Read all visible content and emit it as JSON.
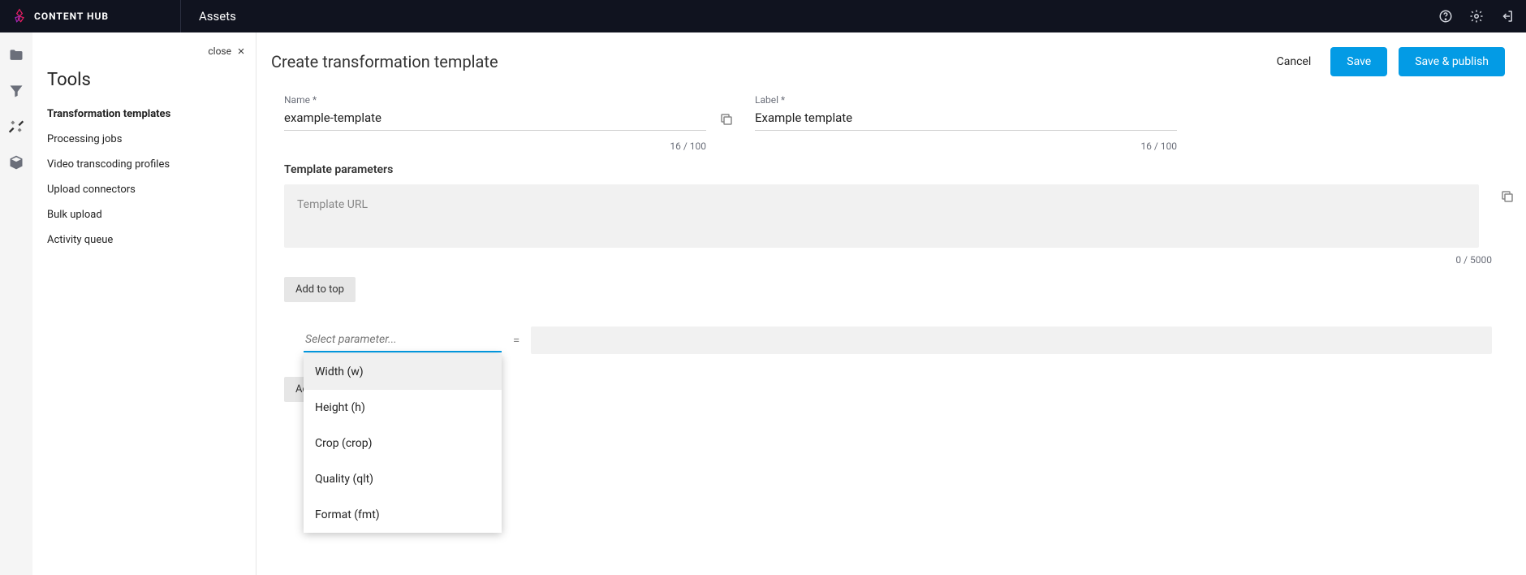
{
  "brand": {
    "name": "CONTENT HUB"
  },
  "topbar": {
    "section": "Assets"
  },
  "sidebar": {
    "close_label": "close",
    "title": "Tools",
    "items": [
      {
        "label": "Transformation templates",
        "active": true
      },
      {
        "label": "Processing jobs"
      },
      {
        "label": "Video transcoding profiles"
      },
      {
        "label": "Upload connectors"
      },
      {
        "label": "Bulk upload"
      },
      {
        "label": "Activity queue"
      }
    ]
  },
  "page": {
    "title": "Create transformation template",
    "cancel_label": "Cancel",
    "save_label": "Save",
    "save_publish_label": "Save & publish"
  },
  "form": {
    "name_label": "Name *",
    "name_value": "example-template",
    "name_count": "16 / 100",
    "label_label": "Label *",
    "label_value": "Example template",
    "label_count": "16 / 100",
    "params_heading": "Template parameters",
    "url_placeholder": "Template URL",
    "url_count": "0 / 5000",
    "add_top_label": "Add to top",
    "select_placeholder": "Select parameter...",
    "equals": "=",
    "add_bottom_partial": "Ad"
  },
  "dropdown": {
    "options": [
      "Width (w)",
      "Height (h)",
      "Crop (crop)",
      "Quality (qlt)",
      "Format (fmt)"
    ]
  }
}
